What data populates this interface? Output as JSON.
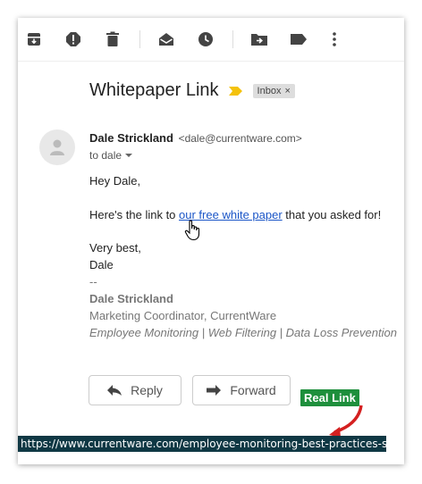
{
  "toolbar": {
    "icons": [
      "archive-icon",
      "report-spam-icon",
      "delete-icon",
      "mark-unread-icon",
      "snooze-icon",
      "move-to-icon",
      "label-icon",
      "more-icon"
    ]
  },
  "email": {
    "subject": "Whitepaper Link",
    "label_badge": "Inbox",
    "label_close": "×",
    "sender_name": "Dale Strickland",
    "sender_address": "<dale@currentware.com>",
    "to_line": "to dale",
    "greeting": "Hey Dale,",
    "line_prefix": "Here's the link to ",
    "link_text": "our free white paper",
    "line_suffix": " that you asked for!",
    "closing": "Very best,",
    "closing_name": "Dale",
    "sig_dashes": "--",
    "sig_name": "Dale Strickland",
    "sig_title": "Marketing Coordinator, CurrentWare",
    "sig_tagline": "Employee Monitoring | Web Filtering | Data Loss Prevention"
  },
  "actions": {
    "reply_label": "Reply",
    "forward_label": "Forward"
  },
  "annotation": {
    "label": "Real Link",
    "color": "#1e8f3c"
  },
  "status_url": "https://www.currentware.com/employee-monitoring-best-practices-sign-up/"
}
